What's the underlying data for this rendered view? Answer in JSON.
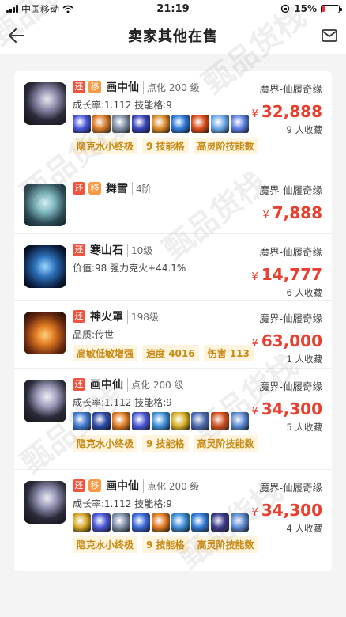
{
  "status_bar": {
    "carrier": "中国移动",
    "time": "21:19",
    "battery_percent": "15%"
  },
  "nav": {
    "title": "卖家其他在售",
    "back_icon": "back-arrow-icon",
    "mail_icon": "mail-icon"
  },
  "watermark_text": "甄品货栈",
  "items": [
    {
      "tags": [
        "还",
        "移"
      ],
      "name": "画中仙",
      "level": "点化 200 级",
      "props": "成长率:1.112  技能格:9",
      "skill_icons": [
        "#4a57d6",
        "#e07b22",
        "#7f8ea8",
        "#3844b8",
        "#d98a2a",
        "#2f7ad8",
        "#d94d18",
        "#6aa7e8",
        "#5a7de0"
      ],
      "chips": [
        "隐克水小终极",
        "9 技能格",
        "高灵阶技能数"
      ],
      "server": "魔界-仙履奇缘",
      "price": "32,888",
      "favorites": "9 人收藏"
    },
    {
      "tags": [
        "还",
        "移"
      ],
      "name": "舞雪",
      "level": "4阶",
      "props": "",
      "skill_icons": [],
      "chips": [],
      "server": "魔界-仙履奇缘",
      "price": "7,888",
      "favorites": ""
    },
    {
      "tags": [
        "还"
      ],
      "name": "寒山石",
      "level": "10级",
      "props": "价值:98  强力克火+44.1%",
      "skill_icons": [],
      "chips": [],
      "server": "魔界-仙履奇缘",
      "price": "14,777",
      "favorites": "6 人收藏"
    },
    {
      "tags": [
        "还"
      ],
      "name": "神火罩",
      "level": "198级",
      "props": "品质:传世",
      "skill_icons": [],
      "chips": [
        "高敏低敏增强",
        "速度 4016",
        "伤害 113"
      ],
      "server": "魔界-仙履奇缘",
      "price": "63,000",
      "favorites": "1 人收藏"
    },
    {
      "tags": [
        "还"
      ],
      "name": "画中仙",
      "level": "点化 200 级",
      "props": "成长率:1.112  技能格:9",
      "skill_icons": [
        "#3a7ad8",
        "#2c4aa8",
        "#e07b22",
        "#4a57d6",
        "#3f8fd8",
        "#d9b02a",
        "#4a6ab8",
        "#d94d18",
        "#5a8ad8"
      ],
      "chips": [
        "隐克水小终极",
        "9 技能格",
        "高灵阶技能数"
      ],
      "server": "魔界-仙履奇缘",
      "price": "34,300",
      "favorites": "5 人收藏"
    },
    {
      "tags": [
        "还",
        "移"
      ],
      "name": "画中仙",
      "level": "点化 200 级",
      "props": "成长率:1.112  技能格:9",
      "skill_icons": [
        "#d9a82a",
        "#4a57d6",
        "#7f8ea8",
        "#3a6ad8",
        "#e07b22",
        "#3f8fd8",
        "#2f7ad8",
        "#3a3a90",
        "#5a8ad8"
      ],
      "chips": [
        "隐克水小终极",
        "9 技能格",
        "高灵阶技能数"
      ],
      "server": "魔界-仙履奇缘",
      "price": "34,300",
      "favorites": "4 人收藏"
    }
  ],
  "colors": {
    "price": "#e8402f",
    "chip_text": "#c98a14",
    "chip_bg": "#fff4dd",
    "tag_return": "#f0543f",
    "tag_transfer": "#f59b45"
  }
}
